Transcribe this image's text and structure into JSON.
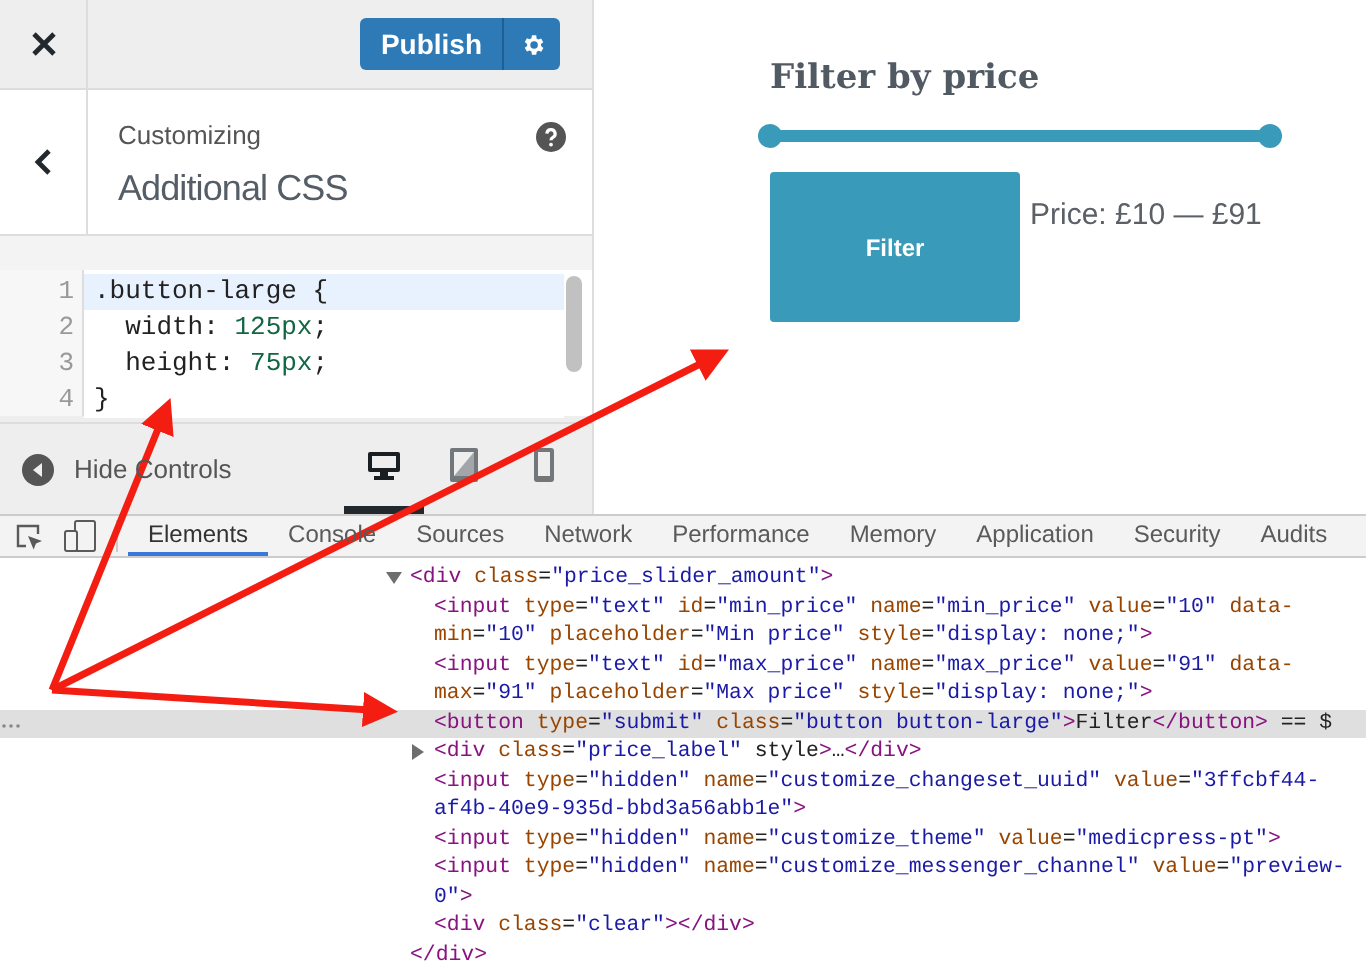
{
  "customizer": {
    "publish_button": "Publish",
    "section": {
      "eyebrow": "Customizing",
      "title": "Additional CSS"
    },
    "code_editor": {
      "lines": [
        {
          "number": "1",
          "code": ".button-large {",
          "active": true
        },
        {
          "number": "2",
          "code": "  width: 125px;",
          "active": false
        },
        {
          "number": "3",
          "code": "  height: 75px;",
          "active": false
        },
        {
          "number": "4",
          "code": "}",
          "active": false
        }
      ]
    },
    "hide_controls": "Hide Controls",
    "devices": [
      {
        "kind": "desktop",
        "selected": true
      },
      {
        "kind": "tablet",
        "selected": false
      },
      {
        "kind": "mobile",
        "selected": false
      }
    ]
  },
  "preview": {
    "title": "Filter by price",
    "slider": {
      "level": 1
    },
    "filter_button": "Filter",
    "price_label": "Price: £10 — £91"
  },
  "devtools": {
    "tabs": [
      {
        "label": "Elements",
        "selected": true
      },
      {
        "label": "Console",
        "selected": false
      },
      {
        "label": "Sources",
        "selected": false
      },
      {
        "label": "Network",
        "selected": false
      },
      {
        "label": "Performance",
        "selected": false
      },
      {
        "label": "Memory",
        "selected": false
      },
      {
        "label": "Application",
        "selected": false
      },
      {
        "label": "Security",
        "selected": false
      },
      {
        "label": "Audits",
        "selected": false
      }
    ],
    "dom": [
      {
        "markup": "<div class=\"price_slider_amount\">",
        "expanded": true,
        "selected": false,
        "closing": "</div>",
        "children": [
          {
            "markup": "<input type=\"text\" id=\"min_price\" name=\"min_price\" value=\"10\" data-min=\"10\" placeholder=\"Min price\" style=\"display: none;\">",
            "selected": false
          },
          {
            "markup": "<input type=\"text\" id=\"max_price\" name=\"max_price\" value=\"91\" data-max=\"91\" placeholder=\"Max price\" style=\"display: none;\">",
            "selected": false
          },
          {
            "markup": "<button type=\"submit\" class=\"button button-large\">Filter</button> == $",
            "selected": true
          },
          {
            "markup": "<div class=\"price_label\" style>…</div>",
            "expanded": false,
            "selected": false
          },
          {
            "markup": "<input type=\"hidden\" name=\"customize_changeset_uuid\" value=\"3ffcbf44-af4b-40e9-935d-bbd3a56abb1e\">",
            "selected": false
          },
          {
            "markup": "<input type=\"hidden\" name=\"customize_theme\" value=\"medicpress-pt\">",
            "selected": false
          },
          {
            "markup": "<input type=\"hidden\" name=\"customize_messenger_channel\" value=\"preview-0\">",
            "selected": false
          },
          {
            "markup": "<div class=\"clear\"></div>",
            "selected": false
          }
        ]
      }
    ]
  }
}
